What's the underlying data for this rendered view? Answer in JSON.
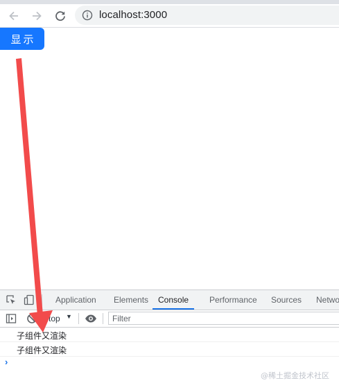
{
  "browser": {
    "url": "localhost:3000",
    "icons": [
      "back-arrow",
      "forward-arrow",
      "reload",
      "site-info"
    ]
  },
  "page": {
    "show_button_label": "显示",
    "button_color": "#1677ff"
  },
  "devtools": {
    "tabs": [
      "Application",
      "Elements",
      "Console",
      "Performance",
      "Sources",
      "Netwo"
    ],
    "active_tab": "Console",
    "context": "top",
    "filter_placeholder": "Filter",
    "logs": [
      "子组件又渲染",
      "子组件又渲染"
    ]
  },
  "annotation": {
    "arrow_color": "#f24b4b"
  },
  "watermark": "@稀土掘金技术社区"
}
